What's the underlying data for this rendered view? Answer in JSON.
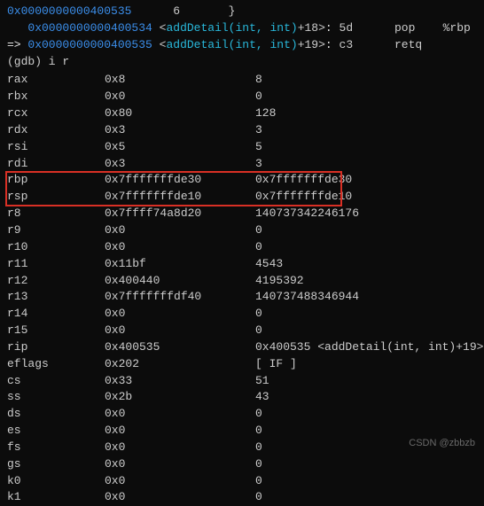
{
  "disasm": {
    "prefix_addr": "0x0000000000400535",
    "prefix_num": "6",
    "prefix_brace": "}",
    "line1": {
      "indent": "   ",
      "addr": "0x0000000000400534",
      "lt": "<",
      "func": "addDetail(int, int)",
      "offset": "+18",
      "gt": ">",
      "colon": ":",
      "sp1": " ",
      "hex": "5d",
      "sp2": "      ",
      "mnemonic": "pop",
      "sp3": "    ",
      "operand": "%rbp"
    },
    "line2": {
      "arrow": "=> ",
      "addr": "0x0000000000400535",
      "lt": "<",
      "func": "addDetail(int, int)",
      "offset": "+19",
      "gt": ">",
      "colon": ":",
      "sp1": " ",
      "hex": "c3",
      "sp2": "      ",
      "mnemonic": "retq",
      "sp3": "",
      "operand": ""
    }
  },
  "prompt": "(gdb) i r",
  "registers": [
    {
      "name": "rax",
      "hex": "0x8",
      "dec": "8"
    },
    {
      "name": "rbx",
      "hex": "0x0",
      "dec": "0"
    },
    {
      "name": "rcx",
      "hex": "0x80",
      "dec": "128"
    },
    {
      "name": "rdx",
      "hex": "0x3",
      "dec": "3"
    },
    {
      "name": "rsi",
      "hex": "0x5",
      "dec": "5"
    },
    {
      "name": "rdi",
      "hex": "0x3",
      "dec": "3"
    },
    {
      "name": "rbp",
      "hex": "0x7fffffffde30",
      "dec": "0x7fffffffde30"
    },
    {
      "name": "rsp",
      "hex": "0x7fffffffde10",
      "dec": "0x7fffffffde10"
    },
    {
      "name": "r8",
      "hex": "0x7ffff74a8d20",
      "dec": "140737342246176"
    },
    {
      "name": "r9",
      "hex": "0x0",
      "dec": "0"
    },
    {
      "name": "r10",
      "hex": "0x0",
      "dec": "0"
    },
    {
      "name": "r11",
      "hex": "0x11bf",
      "dec": "4543"
    },
    {
      "name": "r12",
      "hex": "0x400440",
      "dec": "4195392"
    },
    {
      "name": "r13",
      "hex": "0x7fffffffdf40",
      "dec": "140737488346944"
    },
    {
      "name": "r14",
      "hex": "0x0",
      "dec": "0"
    },
    {
      "name": "r15",
      "hex": "0x0",
      "dec": "0"
    },
    {
      "name": "rip",
      "hex": "0x400535",
      "dec": "0x400535 <addDetail(int, int)+19>"
    },
    {
      "name": "eflags",
      "hex": "0x202",
      "dec": "[ IF ]"
    },
    {
      "name": "cs",
      "hex": "0x33",
      "dec": "51"
    },
    {
      "name": "ss",
      "hex": "0x2b",
      "dec": "43"
    },
    {
      "name": "ds",
      "hex": "0x0",
      "dec": "0"
    },
    {
      "name": "es",
      "hex": "0x0",
      "dec": "0"
    },
    {
      "name": "fs",
      "hex": "0x0",
      "dec": "0"
    },
    {
      "name": "gs",
      "hex": "0x0",
      "dec": "0"
    },
    {
      "name": "k0",
      "hex": "0x0",
      "dec": "0"
    },
    {
      "name": "k1",
      "hex": "0x0",
      "dec": "0"
    }
  ],
  "watermark": "CSDN @zbbzb"
}
